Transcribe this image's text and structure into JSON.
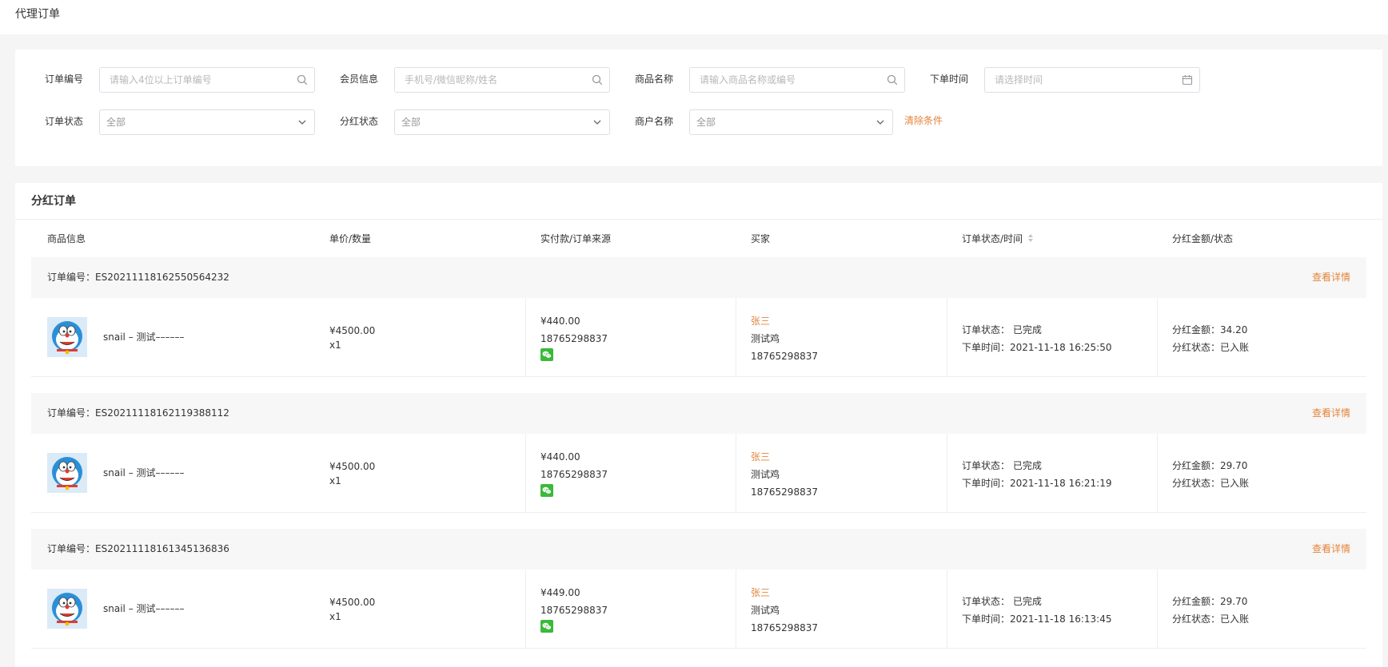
{
  "page_title": "代理订单",
  "filters": {
    "order_no_label": "订单编号",
    "order_no_placeholder": "请输入4位以上订单编号",
    "member_label": "会员信息",
    "member_placeholder": "手机号/微信昵称/姓名",
    "product_label": "商品名称",
    "product_placeholder": "请输入商品名称或编号",
    "time_label": "下单时间",
    "time_placeholder": "请选择时间",
    "order_status_label": "订单状态",
    "order_status_value": "全部",
    "bonus_status_label": "分红状态",
    "bonus_status_value": "全部",
    "merchant_label": "商户名称",
    "merchant_value": "全部",
    "clear_label": "清除条件"
  },
  "table": {
    "title": "分红订单",
    "headers": [
      "商品信息",
      "单价/数量",
      "实付款/订单来源",
      "买家",
      "订单状态/时间",
      "分红金额/状态"
    ],
    "order_no_prefix": "订单编号：",
    "detail_label": "查看详情",
    "status_prefix": "订单状态：",
    "time_prefix": "下单时间：",
    "bonus_amount_prefix": "分红金额：",
    "bonus_status_prefix": "分红状态：",
    "orders": [
      {
        "order_no": "ES20211118162550564232",
        "product": "snail – 测试––––––",
        "price": "¥4500.00",
        "qty": "x1",
        "paid": "¥440.00",
        "source_phone": "18765298837",
        "buyer_name": "张三",
        "buyer_nick": "测试鸡",
        "buyer_phone": "18765298837",
        "status": "已完成",
        "time": "2021-11-18 16:25:50",
        "bonus_amount": "34.20",
        "bonus_status": "已入账"
      },
      {
        "order_no": "ES20211118162119388112",
        "product": "snail – 测试––––––",
        "price": "¥4500.00",
        "qty": "x1",
        "paid": "¥440.00",
        "source_phone": "18765298837",
        "buyer_name": "张三",
        "buyer_nick": "测试鸡",
        "buyer_phone": "18765298837",
        "status": "已完成",
        "time": "2021-11-18 16:21:19",
        "bonus_amount": "29.70",
        "bonus_status": "已入账"
      },
      {
        "order_no": "ES20211118161345136836",
        "product": "snail – 测试––––––",
        "price": "¥4500.00",
        "qty": "x1",
        "paid": "¥449.00",
        "source_phone": "18765298837",
        "buyer_name": "张三",
        "buyer_nick": "测试鸡",
        "buyer_phone": "18765298837",
        "status": "已完成",
        "time": "2021-11-18 16:13:45",
        "bonus_amount": "29.70",
        "bonus_status": "已入账"
      }
    ]
  },
  "colors": {
    "accent": "#e3843a",
    "wechat": "#3bb93b"
  }
}
